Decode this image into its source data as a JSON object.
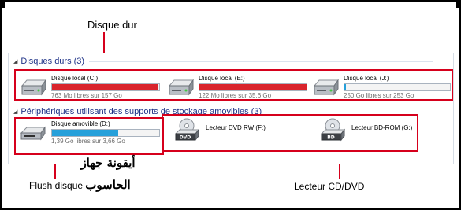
{
  "annotations": {
    "hard_disk_label": "Disque dur",
    "flush_label": "Flush disque",
    "arabic_label": "أيقونة جهاز الحاسوب",
    "cd_label": "Lecteur CD/DVD",
    "highlight_color": "#d6001c"
  },
  "explorer": {
    "hard_drives_header": "Disques durs (3)",
    "removable_header": "Périphériques utilisant des supports de stockage amovibles (3)",
    "hard_drives": [
      {
        "name": "Disque local (C:)",
        "free_text": "763 Mo libres sur 157 Go",
        "used_fraction": 0.995,
        "bar_color": "#d9242d",
        "icon": "hard-drive-icon"
      },
      {
        "name": "Disque local (E:)",
        "free_text": "122 Mo libres sur 35,6 Go",
        "used_fraction": 0.997,
        "bar_color": "#d9242d",
        "icon": "hard-drive-icon"
      },
      {
        "name": "Disque local (J:)",
        "free_text": "250 Go libres sur 253 Go",
        "used_fraction": 0.012,
        "bar_color": "#26a0da",
        "icon": "hard-drive-icon"
      }
    ],
    "removable": {
      "name": "Disque amovible (D:)",
      "free_text": "1,39 Go libres sur 3,66 Go",
      "used_fraction": 0.62,
      "bar_color": "#26a0da",
      "icon": "usb-drive-icon"
    },
    "optical": [
      {
        "name": "Lecteur DVD RW (F:)",
        "icon": "dvd-drive-icon",
        "badge": "DVD"
      },
      {
        "name": "Lecteur BD-ROM (G:)",
        "icon": "bd-drive-icon",
        "badge": "BD"
      }
    ]
  }
}
